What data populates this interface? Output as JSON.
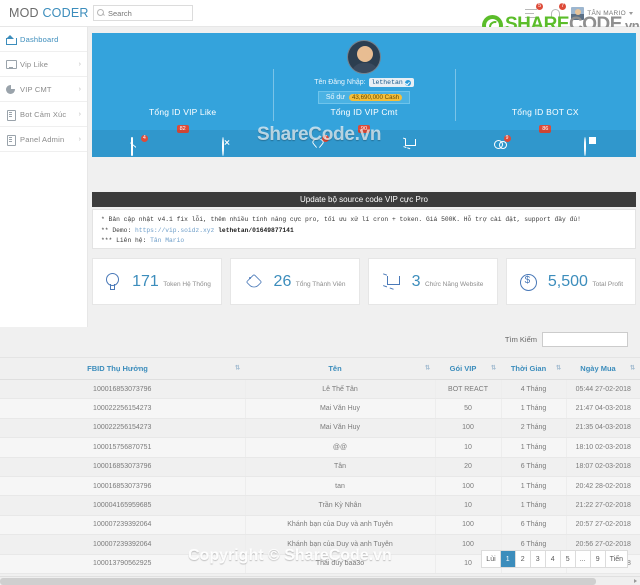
{
  "topbar": {
    "brand_mod": "MOD ",
    "brand_coder": "CODER",
    "search_placeholder": "Search",
    "search_value": "",
    "tasks_badge": "5",
    "bell_badge": "7",
    "user_name": "TÂN MARIO"
  },
  "watermark": {
    "logo_share": "SHARE",
    "logo_code": "CODE",
    "logo_vn": ".vn",
    "banner_text": "ShareCode.vn",
    "footer_text": "Copyright © ShareCode.vn"
  },
  "sidebar": {
    "items": [
      {
        "label": "Dashboard",
        "icon": "home-icon",
        "arrow": "",
        "active": true
      },
      {
        "label": "Vip Like",
        "icon": "monitor-icon",
        "arrow": "›",
        "active": false
      },
      {
        "label": "VIP CMT",
        "icon": "pie-icon",
        "arrow": "›",
        "active": false
      },
      {
        "label": "Bot Cảm Xúc",
        "icon": "doc-icon",
        "arrow": "›",
        "active": false
      },
      {
        "label": "Panel Admin",
        "icon": "doc-icon",
        "arrow": "›",
        "active": false
      }
    ]
  },
  "banner": {
    "login_label": "Tên Đăng Nhập:",
    "username": "lethetan",
    "balance_label": "Số dư",
    "balance_value": "43,690,000 Cash",
    "stats": [
      {
        "title": "Tổng ID VIP Like",
        "count": "82"
      },
      {
        "title": "Tổng ID VIP Cmt",
        "count": "90"
      },
      {
        "title": "Tổng ID BOT CX",
        "count": "86"
      }
    ],
    "icons": [
      {
        "name": "envelope-icon",
        "badge": "4"
      },
      {
        "name": "ban-icon",
        "badge": ""
      },
      {
        "name": "heart-icon",
        "badge": "7"
      },
      {
        "name": "cart-icon",
        "badge": ""
      },
      {
        "name": "mask-icon",
        "badge": "9"
      },
      {
        "name": "clock-icon",
        "badge": ""
      }
    ]
  },
  "update": {
    "bar_title": "Update bộ source code VIP cực Pro",
    "line1": "* Bản cập nhật v4.1 fix lỗi, thêm nhiều tính năng cực pro, tối ưu xử lí cron + token.  Giá 500K. Hỗ trợ cài đặt, support đầy đủ!",
    "line2_prefix": "** Demo: ",
    "line2_link": "https://vip.soidz.xyz",
    "line2_suffix": " lethetan/01649877141",
    "line3_prefix": "*** Liên hệ: ",
    "line3_link": "Tân Mario"
  },
  "cards": [
    {
      "icon": "bulb-icon",
      "value": "171",
      "label": "Token Hệ Thống"
    },
    {
      "icon": "tag-icon",
      "value": "26",
      "label": "Tổng Thành Viên"
    },
    {
      "icon": "cart-icon",
      "value": "3",
      "label": "Chức Năng Website"
    },
    {
      "icon": "coin-icon",
      "value": "5,500",
      "label": "Total Profit"
    }
  ],
  "table": {
    "search_label": "Tìm Kiếm",
    "search_value": "",
    "columns": [
      "FBID Thụ Hưởng",
      "Tên",
      "Gói VIP",
      "Thời Gian",
      "Ngày Mua"
    ],
    "rows": [
      [
        "100016853073796",
        "Lê Thế Tân",
        "BOT REACT",
        "4 Tháng",
        "05:44 27-02-2018"
      ],
      [
        "100022256154273",
        "Mai Văn Huy",
        "50",
        "1 Tháng",
        "21:47 04-03-2018"
      ],
      [
        "100022256154273",
        "Mai Văn Huy",
        "100",
        "2 Tháng",
        "21:35 04-03-2018"
      ],
      [
        "100015756870751",
        "@@",
        "10",
        "1 Tháng",
        "18:10 02-03-2018"
      ],
      [
        "100016853073796",
        "Tân",
        "20",
        "6 Tháng",
        "18:07 02-03-2018"
      ],
      [
        "100016853073796",
        "tan",
        "100",
        "1 Tháng",
        "20:42 28-02-2018"
      ],
      [
        "100004165959685",
        "Trần Kỳ Nhân",
        "10",
        "1 Tháng",
        "21:22 27-02-2018"
      ],
      [
        "100007239392064",
        "Khánh bạn của Duy và anh Tuyên",
        "100",
        "6 Tháng",
        "20:57 27-02-2018"
      ],
      [
        "100007239392064",
        "Khánh bạn của Duy và anh Tuyên",
        "100",
        "6 Tháng",
        "20:56 27-02-2018"
      ],
      [
        "100013790562925",
        "Thái duy baa3o",
        "10",
        "1 Tháng",
        "19:58 27-02-2018"
      ]
    ]
  },
  "pagination": {
    "prev": "Lùi",
    "pages": [
      "1",
      "2",
      "3",
      "4",
      "5",
      "...",
      "9"
    ],
    "active": "1",
    "next": "Tiến"
  }
}
